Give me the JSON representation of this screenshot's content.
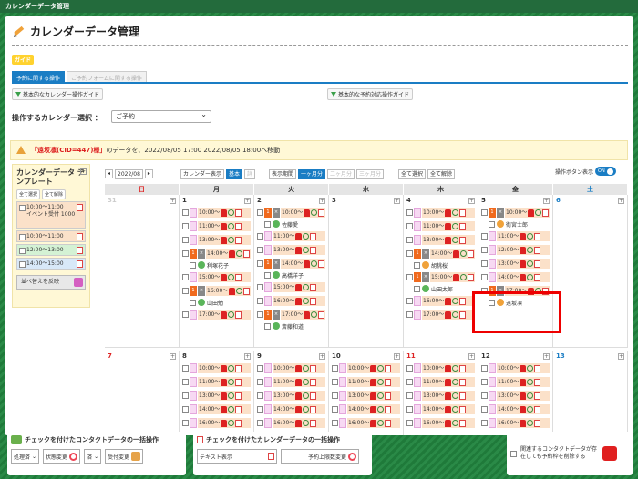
{
  "window_title": "カレンダーデータ管理",
  "page_title": "カレンダーデータ管理",
  "guide_label": "ガイド",
  "tabs": [
    "予約に関する操作",
    "ご予約フォームに関する操作"
  ],
  "guide_buttons": [
    "基本的なカレンダー操作ガイド",
    "基本的な予約対応操作ガイド"
  ],
  "calendar_select": {
    "label": "操作するカレンダー選択 ：",
    "value": "ご予約"
  },
  "notice": {
    "highlight": "「遠坂凛(CID=447)様」",
    "text": "のデータを、2022/08/05 17:00 2022/08/05 18:00へ移動"
  },
  "template": {
    "title": "カレンダーデータ テンプレート",
    "select_all": "全て選択",
    "deselect_all": "全て解除",
    "items": [
      {
        "time": "10:00〜11:00",
        "note": "イベント受付 1000",
        "color": "#fbe1c9"
      },
      {
        "time": "10:00〜11:00",
        "note": "",
        "color": "#fbe1c9"
      },
      {
        "time": "12:00〜13:00",
        "note": "",
        "color": "#d4f2d4"
      },
      {
        "time": "14:00〜15:00",
        "note": "",
        "color": "#d8e8f8"
      }
    ],
    "sort_label": "並べ替えを反映"
  },
  "controls": {
    "month": "2022/08",
    "display_label": "カレンダー表示",
    "basic": "基本",
    "detail": "詳",
    "period_label": "表示期間",
    "periods": [
      "一ヶ月分",
      "二ヶ月分",
      "三ヶ月分"
    ],
    "select_all": "全て選択",
    "deselect_all": "全て解除",
    "buttons_label": "操作ボタン表示",
    "toggle": "ON"
  },
  "weekdays": [
    "日",
    "月",
    "火",
    "水",
    "木",
    "金",
    "土"
  ],
  "week1": [
    {
      "num": "31",
      "type": "gray",
      "slots": []
    },
    {
      "num": "1",
      "type": "",
      "slots": [
        {
          "kind": "t",
          "time": "10:00"
        },
        {
          "kind": "t",
          "time": "11:00"
        },
        {
          "kind": "t",
          "time": "13:00"
        },
        {
          "kind": "t",
          "time": "14:00"
        },
        {
          "kind": "t",
          "time": "15:00"
        },
        {
          "kind": "t",
          "time": "16:00"
        },
        {
          "kind": "t",
          "time": "17:00"
        }
      ]
    },
    {
      "num": "2",
      "type": "",
      "slots": [
        {
          "kind": "t",
          "time": "10:00"
        },
        {
          "kind": "t",
          "time": "11:00"
        },
        {
          "kind": "t",
          "time": "13:00"
        },
        {
          "kind": "t",
          "time": "14:00"
        },
        {
          "kind": "t",
          "time": "15:00"
        },
        {
          "kind": "t",
          "time": "16:00"
        },
        {
          "kind": "t",
          "time": "17:00"
        }
      ]
    },
    {
      "num": "3",
      "type": "",
      "slots": []
    },
    {
      "num": "4",
      "type": "",
      "slots": [
        {
          "kind": "t",
          "time": "10:00"
        },
        {
          "kind": "t",
          "time": "11:00"
        },
        {
          "kind": "t",
          "time": "13:00"
        },
        {
          "kind": "t",
          "time": "14:00"
        },
        {
          "kind": "t",
          "time": "15:00"
        },
        {
          "kind": "t",
          "time": "16:00"
        },
        {
          "kind": "t",
          "time": "17:00"
        }
      ]
    },
    {
      "num": "5",
      "type": "",
      "slots": [
        {
          "kind": "t",
          "time": "10:00"
        },
        {
          "kind": "t",
          "time": "11:00"
        },
        {
          "kind": "t",
          "time": "12:00"
        },
        {
          "kind": "t",
          "time": "13:00"
        },
        {
          "kind": "t",
          "time": "14:00"
        },
        {
          "kind": "t",
          "time": "17:00"
        }
      ]
    },
    {
      "num": "6",
      "type": "sat",
      "slots": []
    }
  ],
  "week1_contacts": {
    "1": [
      {
        "after": 3,
        "name": "利塚花子",
        "o": false
      },
      {
        "after": 5,
        "name": "山田勉",
        "o": false
      }
    ],
    "2": [
      {
        "after": 0,
        "name": "佐藤愛",
        "o": false
      },
      {
        "after": 3,
        "name": "高橋洋子",
        "o": false
      },
      {
        "after": 6,
        "name": "斎藤和道",
        "o": false
      }
    ],
    "4": [
      {
        "after": 3,
        "name": "胡桃桜",
        "o": true
      },
      {
        "after": 4,
        "name": "山田太郎",
        "o": false
      }
    ],
    "5": [
      {
        "after": 0,
        "name": "衛宮士郎",
        "o": true
      },
      {
        "after": 5,
        "name": "遠坂凛",
        "o": true
      }
    ]
  },
  "week2": [
    {
      "num": "7",
      "type": "sun",
      "slots": []
    },
    {
      "num": "8",
      "type": "",
      "slots": [
        {
          "kind": "t",
          "time": "10:00"
        },
        {
          "kind": "t",
          "time": "11:00"
        },
        {
          "kind": "t",
          "time": "13:00"
        },
        {
          "kind": "t",
          "time": "14:00"
        },
        {
          "kind": "t",
          "time": "16:00"
        }
      ]
    },
    {
      "num": "9",
      "type": "",
      "slots": [
        {
          "kind": "t",
          "time": "10:00"
        },
        {
          "kind": "t",
          "time": "11:00"
        },
        {
          "kind": "t",
          "time": "13:00"
        },
        {
          "kind": "t",
          "time": "14:00"
        },
        {
          "kind": "t",
          "time": "16:00"
        }
      ]
    },
    {
      "num": "10",
      "type": "",
      "slots": [
        {
          "kind": "t",
          "time": "10:00"
        },
        {
          "kind": "t",
          "time": "11:00"
        },
        {
          "kind": "t",
          "time": "13:00"
        },
        {
          "kind": "t",
          "time": "14:00"
        },
        {
          "kind": "t",
          "time": "16:00"
        }
      ]
    },
    {
      "num": "11",
      "type": "sun",
      "slots": [
        {
          "kind": "t",
          "time": "10:00"
        },
        {
          "kind": "t",
          "time": "11:00"
        },
        {
          "kind": "t",
          "time": "13:00"
        },
        {
          "kind": "t",
          "time": "14:00"
        },
        {
          "kind": "t",
          "time": "16:00"
        }
      ]
    },
    {
      "num": "12",
      "type": "",
      "slots": [
        {
          "kind": "t",
          "time": "10:00"
        },
        {
          "kind": "t",
          "time": "11:00"
        },
        {
          "kind": "t",
          "time": "13:00"
        },
        {
          "kind": "t",
          "time": "14:00"
        },
        {
          "kind": "t",
          "time": "16:00"
        }
      ]
    },
    {
      "num": "13",
      "type": "sat",
      "slots": []
    }
  ],
  "bulk_contact": {
    "title": "チェックを付けたコンタクトデータの一括操作",
    "status_sel": "処理済",
    "status_btn": "状態変更",
    "vis_sel": "済",
    "vis_btn": "受付変更"
  },
  "bulk_calendar": {
    "title": "チェックを付けたカレンダーデータの一括操作",
    "text_label": "テキスト表示",
    "capacity_btn": "予約上限数変更"
  },
  "delete_option": "関連するコンタクトデータが存在しても予約枠を削除する"
}
